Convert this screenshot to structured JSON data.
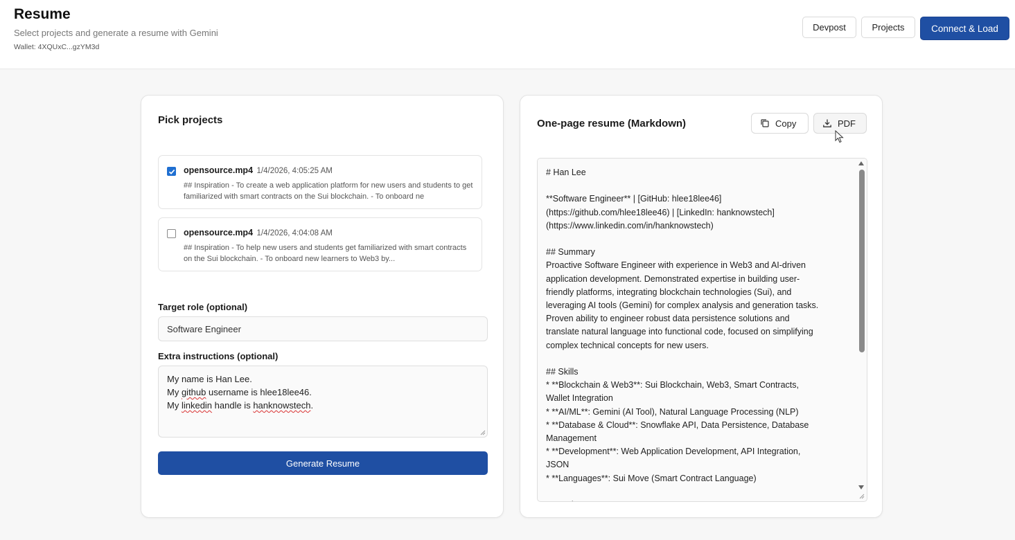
{
  "header": {
    "title": "Resume",
    "subtitle": "Select projects and generate a resume with Gemini",
    "wallet": "Wallet: 4XQUxC...gzYM3d",
    "buttons": {
      "devpost": "Devpost",
      "projects": "Projects",
      "connect": "Connect & Load"
    }
  },
  "left": {
    "title": "Pick projects",
    "projects": [
      {
        "name": "opensource.mp4",
        "date": "1/4/2026, 4:05:25 AM",
        "checked": true,
        "desc": "## Inspiration - To create a web application platform for new users and students to get familiarized with smart contracts on the Sui blockchain. - To onboard ne"
      },
      {
        "name": "opensource.mp4",
        "date": "1/4/2026, 4:04:08 AM",
        "checked": false,
        "desc": "## Inspiration - To help new users and students get familiarized with smart contracts on the Sui blockchain. - To onboard new learners to Web3 by..."
      }
    ],
    "role_label": "Target role (optional)",
    "role_value": "Software Engineer",
    "extra_label": "Extra instructions (optional)",
    "extra_lines": {
      "l1": "My name is Han Lee.",
      "l2_a": "My ",
      "l2_b": "github",
      "l2_c": " username is hlee18lee46.",
      "l3_a": "My ",
      "l3_b": "linkedin",
      "l3_c": " handle is ",
      "l3_d": "hanknowstech",
      "l3_e": "."
    },
    "generate_label": "Generate Resume"
  },
  "right": {
    "title": "One-page resume (Markdown)",
    "copy_label": "Copy",
    "pdf_label": "PDF",
    "markdown_lines": [
      "# Han Lee",
      "",
      "**Software Engineer** | [GitHub: hlee18lee46]",
      "(https://github.com/hlee18lee46) | [LinkedIn: hanknowstech]",
      "(https://www.linkedin.com/in/hanknowstech)",
      "",
      "## Summary",
      "Proactive Software Engineer with experience in Web3 and AI-driven",
      "application development. Demonstrated expertise in building user-",
      "friendly platforms, integrating blockchain technologies (Sui), and",
      "leveraging AI tools (Gemini) for complex analysis and generation tasks.",
      "Proven ability to engineer robust data persistence solutions and",
      "translate natural language into functional code, focused on simplifying",
      "complex technical concepts for new users.",
      "",
      "## Skills",
      "*   **Blockchain & Web3**: Sui Blockchain, Web3, Smart Contracts,",
      "Wallet Integration",
      "*   **AI/ML**: Gemini (AI Tool), Natural Language Processing (NLP)",
      "*   **Database & Cloud**: Snowflake API, Data Persistence, Database",
      "Management",
      "*   **Development**: Web Application Development, API Integration,",
      "JSON",
      "*   **Languages**: Sui Move (Smart Contract Language)",
      "",
      "## Projects"
    ]
  },
  "colors": {
    "primary": "#1f4fa3",
    "checkbox": "#1f6fd1",
    "background": "#f7f7f7"
  }
}
